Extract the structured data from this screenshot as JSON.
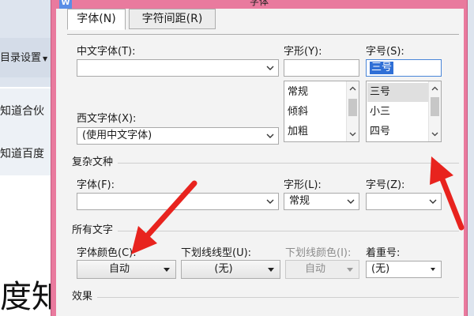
{
  "background": {
    "menu_label": "目录设置",
    "rows": [
      "知道合伙",
      "知道百度"
    ],
    "big_text": "度知"
  },
  "dialog": {
    "title": "字体",
    "tabs": [
      {
        "label": "字体(N)",
        "active": true
      },
      {
        "label": "字符间距(R)",
        "active": false
      }
    ],
    "chinese_font": {
      "label": "中文字体(T):",
      "value": ""
    },
    "style": {
      "label": "字形(Y):",
      "value": "",
      "options": [
        "常规",
        "倾斜",
        "加粗"
      ]
    },
    "size": {
      "label": "字号(S):",
      "value": "三号",
      "options": [
        "三号",
        "小三",
        "四号"
      ],
      "selected": "三号"
    },
    "western_font": {
      "label": "西文字体(X):",
      "value": "(使用中文字体)"
    },
    "complex": {
      "heading": "复杂文种",
      "font": {
        "label": "字体(F):",
        "value": ""
      },
      "style": {
        "label": "字形(L):",
        "value": "常规"
      },
      "size": {
        "label": "字号(Z):",
        "value": ""
      }
    },
    "all_text": {
      "heading": "所有文字",
      "font_color": {
        "label": "字体颜色(C):",
        "value": "自动"
      },
      "underline_type": {
        "label": "下划线线型(U):",
        "value": "(无)"
      },
      "underline_color": {
        "label": "下划线颜色(I):",
        "value": "自动",
        "disabled": true
      },
      "emphasis": {
        "label": "着重号:",
        "value": "(无)"
      }
    },
    "effects_heading": "效果"
  },
  "colors": {
    "dialog_frame": "#e97a9e",
    "selection": "#2f6fd6",
    "annotation_arrow": "#e8231e"
  }
}
